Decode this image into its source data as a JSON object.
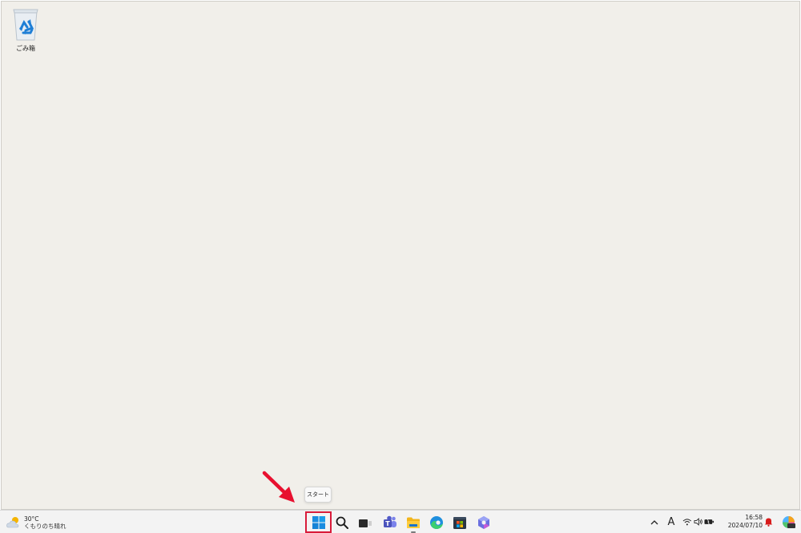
{
  "desktop": {
    "recycle_bin": {
      "label": "ごみ箱",
      "icon": "recycle-bin-icon"
    },
    "background_color": "#f1efea"
  },
  "tooltip": {
    "text": "スタート"
  },
  "annotation": {
    "arrow_color": "#e8102f",
    "highlight_color": "#d81b3a"
  },
  "taskbar": {
    "weather": {
      "temperature": "30°C",
      "condition": "くもりのち晴れ",
      "icon": "partly-cloudy-icon"
    },
    "apps": [
      {
        "name": "start",
        "icon": "windows-start-icon"
      },
      {
        "name": "search",
        "icon": "search-icon"
      },
      {
        "name": "task-view",
        "icon": "task-view-icon"
      },
      {
        "name": "teams",
        "icon": "teams-icon"
      },
      {
        "name": "file-explorer",
        "icon": "folder-icon",
        "running": true
      },
      {
        "name": "edge",
        "icon": "edge-icon"
      },
      {
        "name": "store",
        "icon": "store-icon"
      },
      {
        "name": "copilot",
        "icon": "copilot-icon"
      }
    ],
    "tray": {
      "ime_mode": "A",
      "icons": [
        "chevron-up-icon",
        "wifi-icon",
        "volume-icon",
        "battery-icon"
      ]
    },
    "clock": {
      "time": "16:58",
      "date": "2024/07/10"
    }
  }
}
